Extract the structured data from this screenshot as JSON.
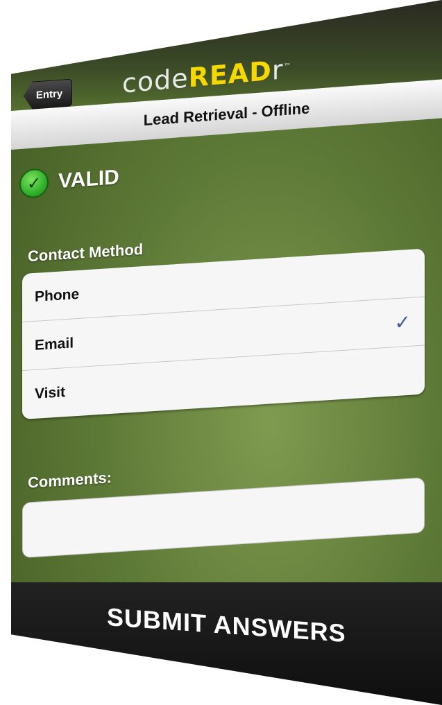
{
  "nav": {
    "back_label": "Entry",
    "logo": {
      "code": "code",
      "read": "READ",
      "r": "r",
      "tm": "™"
    }
  },
  "subtitle": "Lead Retrieval - Offline",
  "status": {
    "label": "VALID",
    "icon": "check-circle-icon",
    "color": "#2fb12a"
  },
  "contact_method": {
    "label": "Contact Method",
    "options": [
      {
        "label": "Phone",
        "selected": false
      },
      {
        "label": "Email",
        "selected": true
      },
      {
        "label": "Visit",
        "selected": false
      }
    ],
    "check_glyph": "✓",
    "check_color": "#3b5d9c"
  },
  "comments": {
    "label": "Comments:",
    "value": ""
  },
  "submit": {
    "label": "SUBMIT ANSWERS"
  },
  "colors": {
    "accent_yellow": "#f5d800",
    "background_green": "#5e7a37"
  }
}
